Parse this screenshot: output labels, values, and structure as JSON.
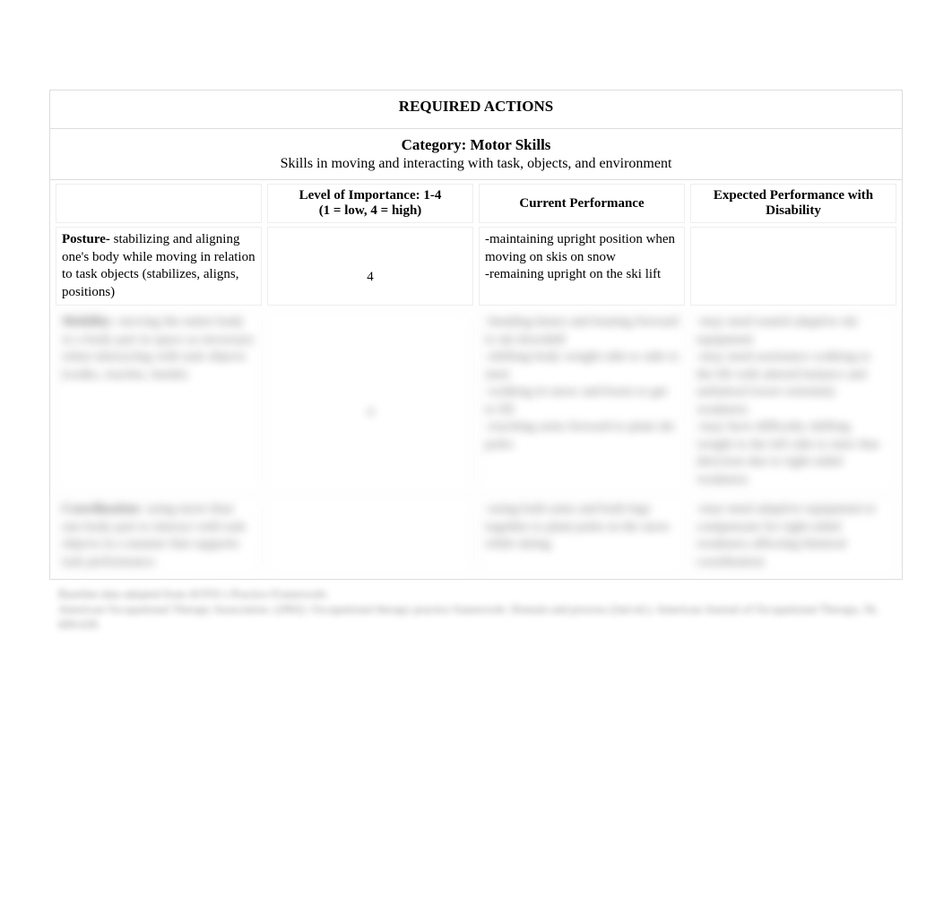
{
  "title": "REQUIRED ACTIONS",
  "category_label": "Category: Motor Skills",
  "category_desc": "Skills in moving and interacting with task, objects, and environment",
  "headers": {
    "col1": "",
    "col2_line1": "Level of Importance: 1-4",
    "col2_line2": "(1 = low, 4 = high)",
    "col3": "Current Performance",
    "col4": "Expected Performance with Disability"
  },
  "rows": [
    {
      "term": "Posture- ",
      "definition": "stabilizing and aligning one's body while moving in relation to task objects (stabilizes, aligns, positions)",
      "rating": "4",
      "current": "-maintaining upright position when moving on skis on snow\n-remaining upright on the ski lift",
      "expected": ""
    },
    {
      "term": "Mobility- ",
      "definition": "moving the entire body or a body part in space as necessary when interacting with task objects (walks, reaches, bends)",
      "rating": "4",
      "current": "-bending knees and leaning forward to ski downhill\n-shifting body weight side to side to steer\n-walking in snow and boots to get to lift\n-reaching arms forward to plant ski poles",
      "expected": "-may need seated adaptive ski equipment\n-may need assistance walking to the lift with altered balance and unilateral lower extremity weakness\n-may have difficulty shifting weight to the left side to steer that direction due to right-sided weakness"
    },
    {
      "term": "Coordination- ",
      "definition": "using more than one body part to interact with task objects in a manner that supports task performance",
      "rating": "",
      "current": "-using both arms and both legs together to plant poles in the snow while skiing",
      "expected": "-may need adaptive equipment to compensate for right-sided weakness affecting bilateral coordination"
    }
  ],
  "footnote": "Baseline data adopted from AOTAʼs Practice Framework:\nAmerican Occupational Therapy Association. (2002). Occupational therapy practice framework: Domain and process (2nd ed.). American Journal of Occupational Therapy, 56, 609-639."
}
